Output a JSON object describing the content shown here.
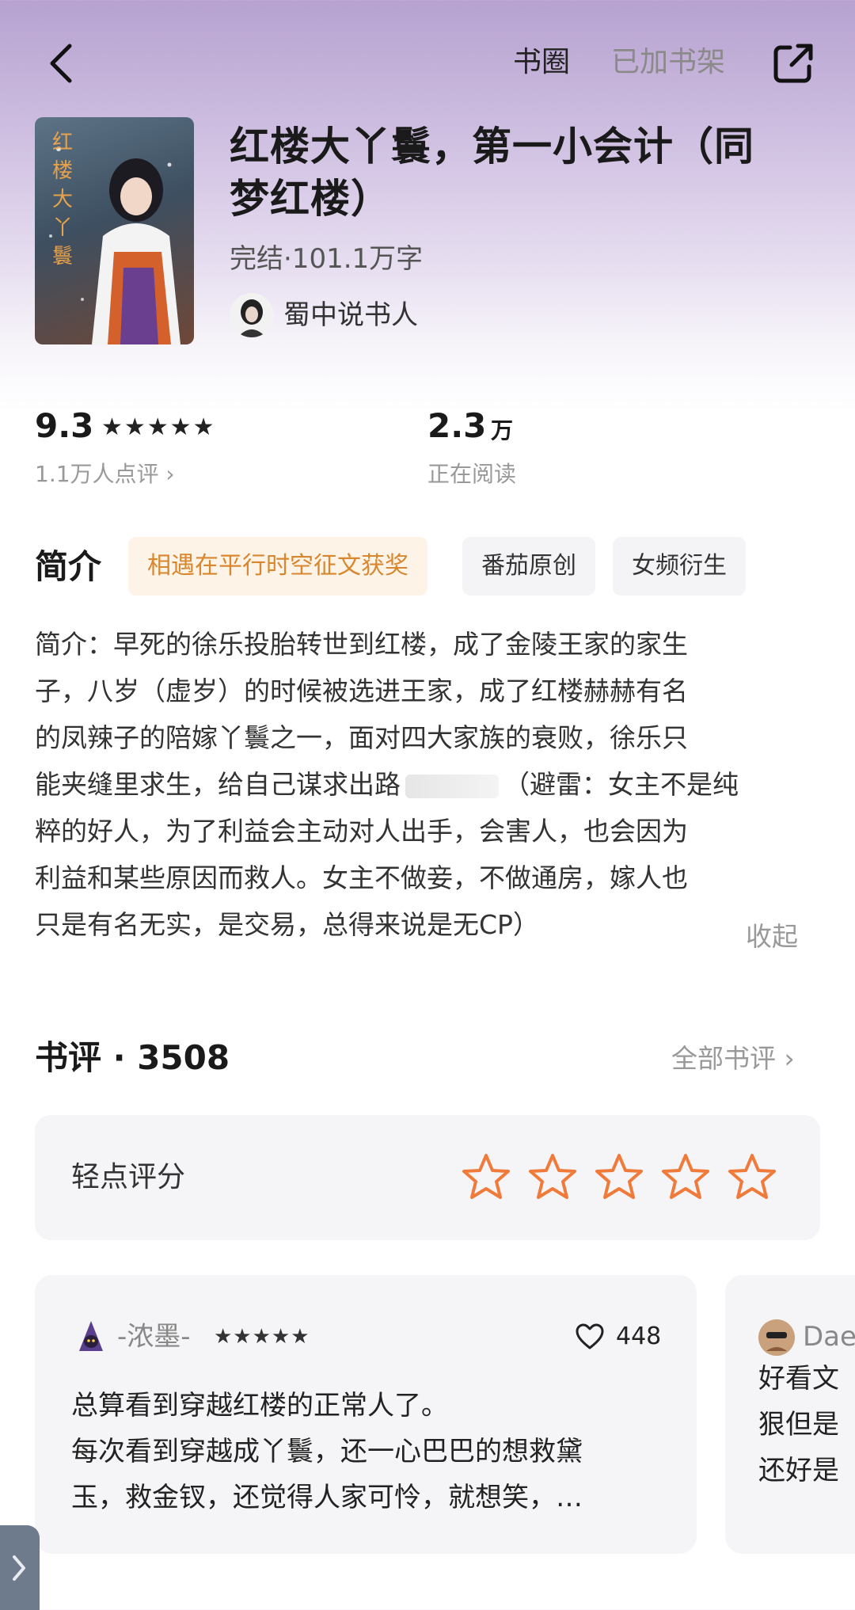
{
  "topbar": {
    "circle_label": "书圈",
    "shelf_label": "已加书架"
  },
  "book": {
    "title_line1": "红楼大丫鬟，第一小会计（同",
    "title_line2": "梦红楼）",
    "meta": "完结·101.1万字",
    "author": "蜀中说书人"
  },
  "stats": {
    "rating": "9.3",
    "stars": "★★★★★",
    "rating_count": "1.1万人点评 ›",
    "reading": "2.3",
    "reading_unit": "万",
    "reading_label": "正在阅读"
  },
  "intro": {
    "heading": "简介",
    "tags": [
      "相遇在平行时空征文获奖",
      "番茄原创",
      "女频衍生"
    ],
    "lines": [
      "简介：早死的徐乐投胎转世到红楼，成了金陵王家的家生",
      "子，八岁（虚岁）的时候被选进王家，成了红楼赫赫有名",
      "的凤辣子的陪嫁丫鬟之一，面对四大家族的衰败，徐乐只",
      "能夹缝里求生，给自己谋求出路",
      "（避雷：女主不是纯",
      "粹的好人，为了利益会主动对人出手，会害人，也会因为",
      "利益和某些原因而救人。女主不做妾，不做通房，嫁人也",
      "只是有名无实，是交易，总得来说是无CP）"
    ],
    "collapse": "收起"
  },
  "reviews": {
    "heading": "书评 · 3508",
    "all_link": "全部书评 ›",
    "rate_label": "轻点评分",
    "items": [
      {
        "user": "-浓墨-",
        "stars": "★★★★★",
        "likes": "448",
        "lines": [
          "总算看到穿越红楼的正常人了。",
          "每次看到穿越成丫鬟，还一心巴巴的想救黛",
          "玉，救金钗，还觉得人家可怜，就想笑，…"
        ]
      },
      {
        "user": "Dae",
        "lines": [
          "好看文",
          "狠但是",
          "还好是"
        ]
      }
    ]
  },
  "colors": {
    "accent": "#f07a3a",
    "award_tag_text": "#d9872f",
    "award_tag_bg": "#fdf3e6"
  }
}
